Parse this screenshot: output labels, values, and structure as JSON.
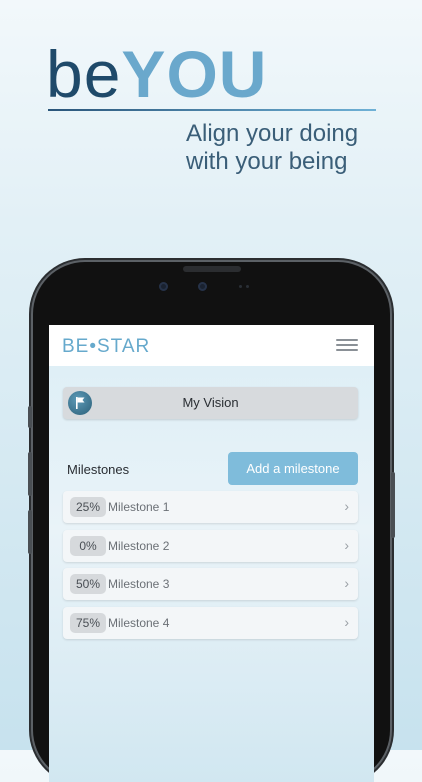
{
  "hero": {
    "brand_light": "be",
    "brand_bold": "YOU",
    "tagline_line1": "Align your doing",
    "tagline_line2": "with your being"
  },
  "app": {
    "logo": "BE•STAR",
    "vision_button": "My Vision",
    "milestones_title": "Milestones",
    "add_button": "Add a milestone",
    "milestones": [
      {
        "percent": "25%",
        "name": "Milestone 1"
      },
      {
        "percent": "0%",
        "name": "Milestone 2"
      },
      {
        "percent": "50%",
        "name": "Milestone 3"
      },
      {
        "percent": "75%",
        "name": "Milestone 4"
      }
    ]
  },
  "icons": {
    "menu": "hamburger-menu-icon",
    "vision": "flag-icon",
    "chevron": "chevron-right-icon"
  },
  "colors": {
    "accent": "#7fbcdb",
    "brand_dark": "#1f4a6a",
    "brand_light": "#6aa8cc"
  }
}
